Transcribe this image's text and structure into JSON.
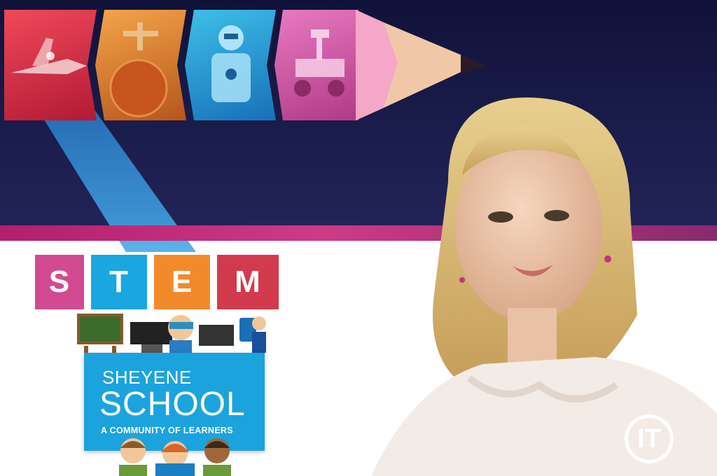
{
  "stem_letters": [
    "S",
    "T",
    "E",
    "M"
  ],
  "school": {
    "name_line1": "SHEYENE",
    "name_line2": "SCHOOL",
    "tagline": "A COMMUNITY OF LEARNERS"
  },
  "logo_text": "IT",
  "colors": {
    "banner": "#1a1c4a",
    "stripe": "#cd3a86",
    "stem_s": "#d24b92",
    "stem_t": "#1aa6df",
    "stem_e": "#f28a2c",
    "stem_m": "#d23a4e",
    "school_card": "#1ba3de"
  }
}
